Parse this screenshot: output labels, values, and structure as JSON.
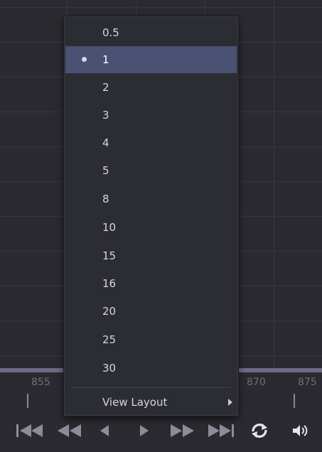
{
  "menu": {
    "items": [
      {
        "label": "0.5",
        "selected": false
      },
      {
        "label": "1",
        "selected": true
      },
      {
        "label": "2",
        "selected": false
      },
      {
        "label": "3",
        "selected": false
      },
      {
        "label": "4",
        "selected": false
      },
      {
        "label": "5",
        "selected": false
      },
      {
        "label": "8",
        "selected": false
      },
      {
        "label": "10",
        "selected": false
      },
      {
        "label": "15",
        "selected": false
      },
      {
        "label": "16",
        "selected": false
      },
      {
        "label": "20",
        "selected": false
      },
      {
        "label": "25",
        "selected": false
      },
      {
        "label": "30",
        "selected": false
      }
    ],
    "view_layout_label": "View Layout"
  },
  "ruler": {
    "labels": [
      "855",
      "870",
      "875"
    ]
  },
  "transport": {
    "icons": [
      "go-to-start-icon",
      "rewind-icon",
      "step-back-icon",
      "play-icon",
      "fast-forward-icon",
      "go-to-end-icon",
      "loop-icon",
      "volume-icon"
    ]
  },
  "colors": {
    "selected_bg": "#4a5173",
    "menu_bg": "#2c2c33",
    "timeline_bar": "#6d6d86"
  }
}
